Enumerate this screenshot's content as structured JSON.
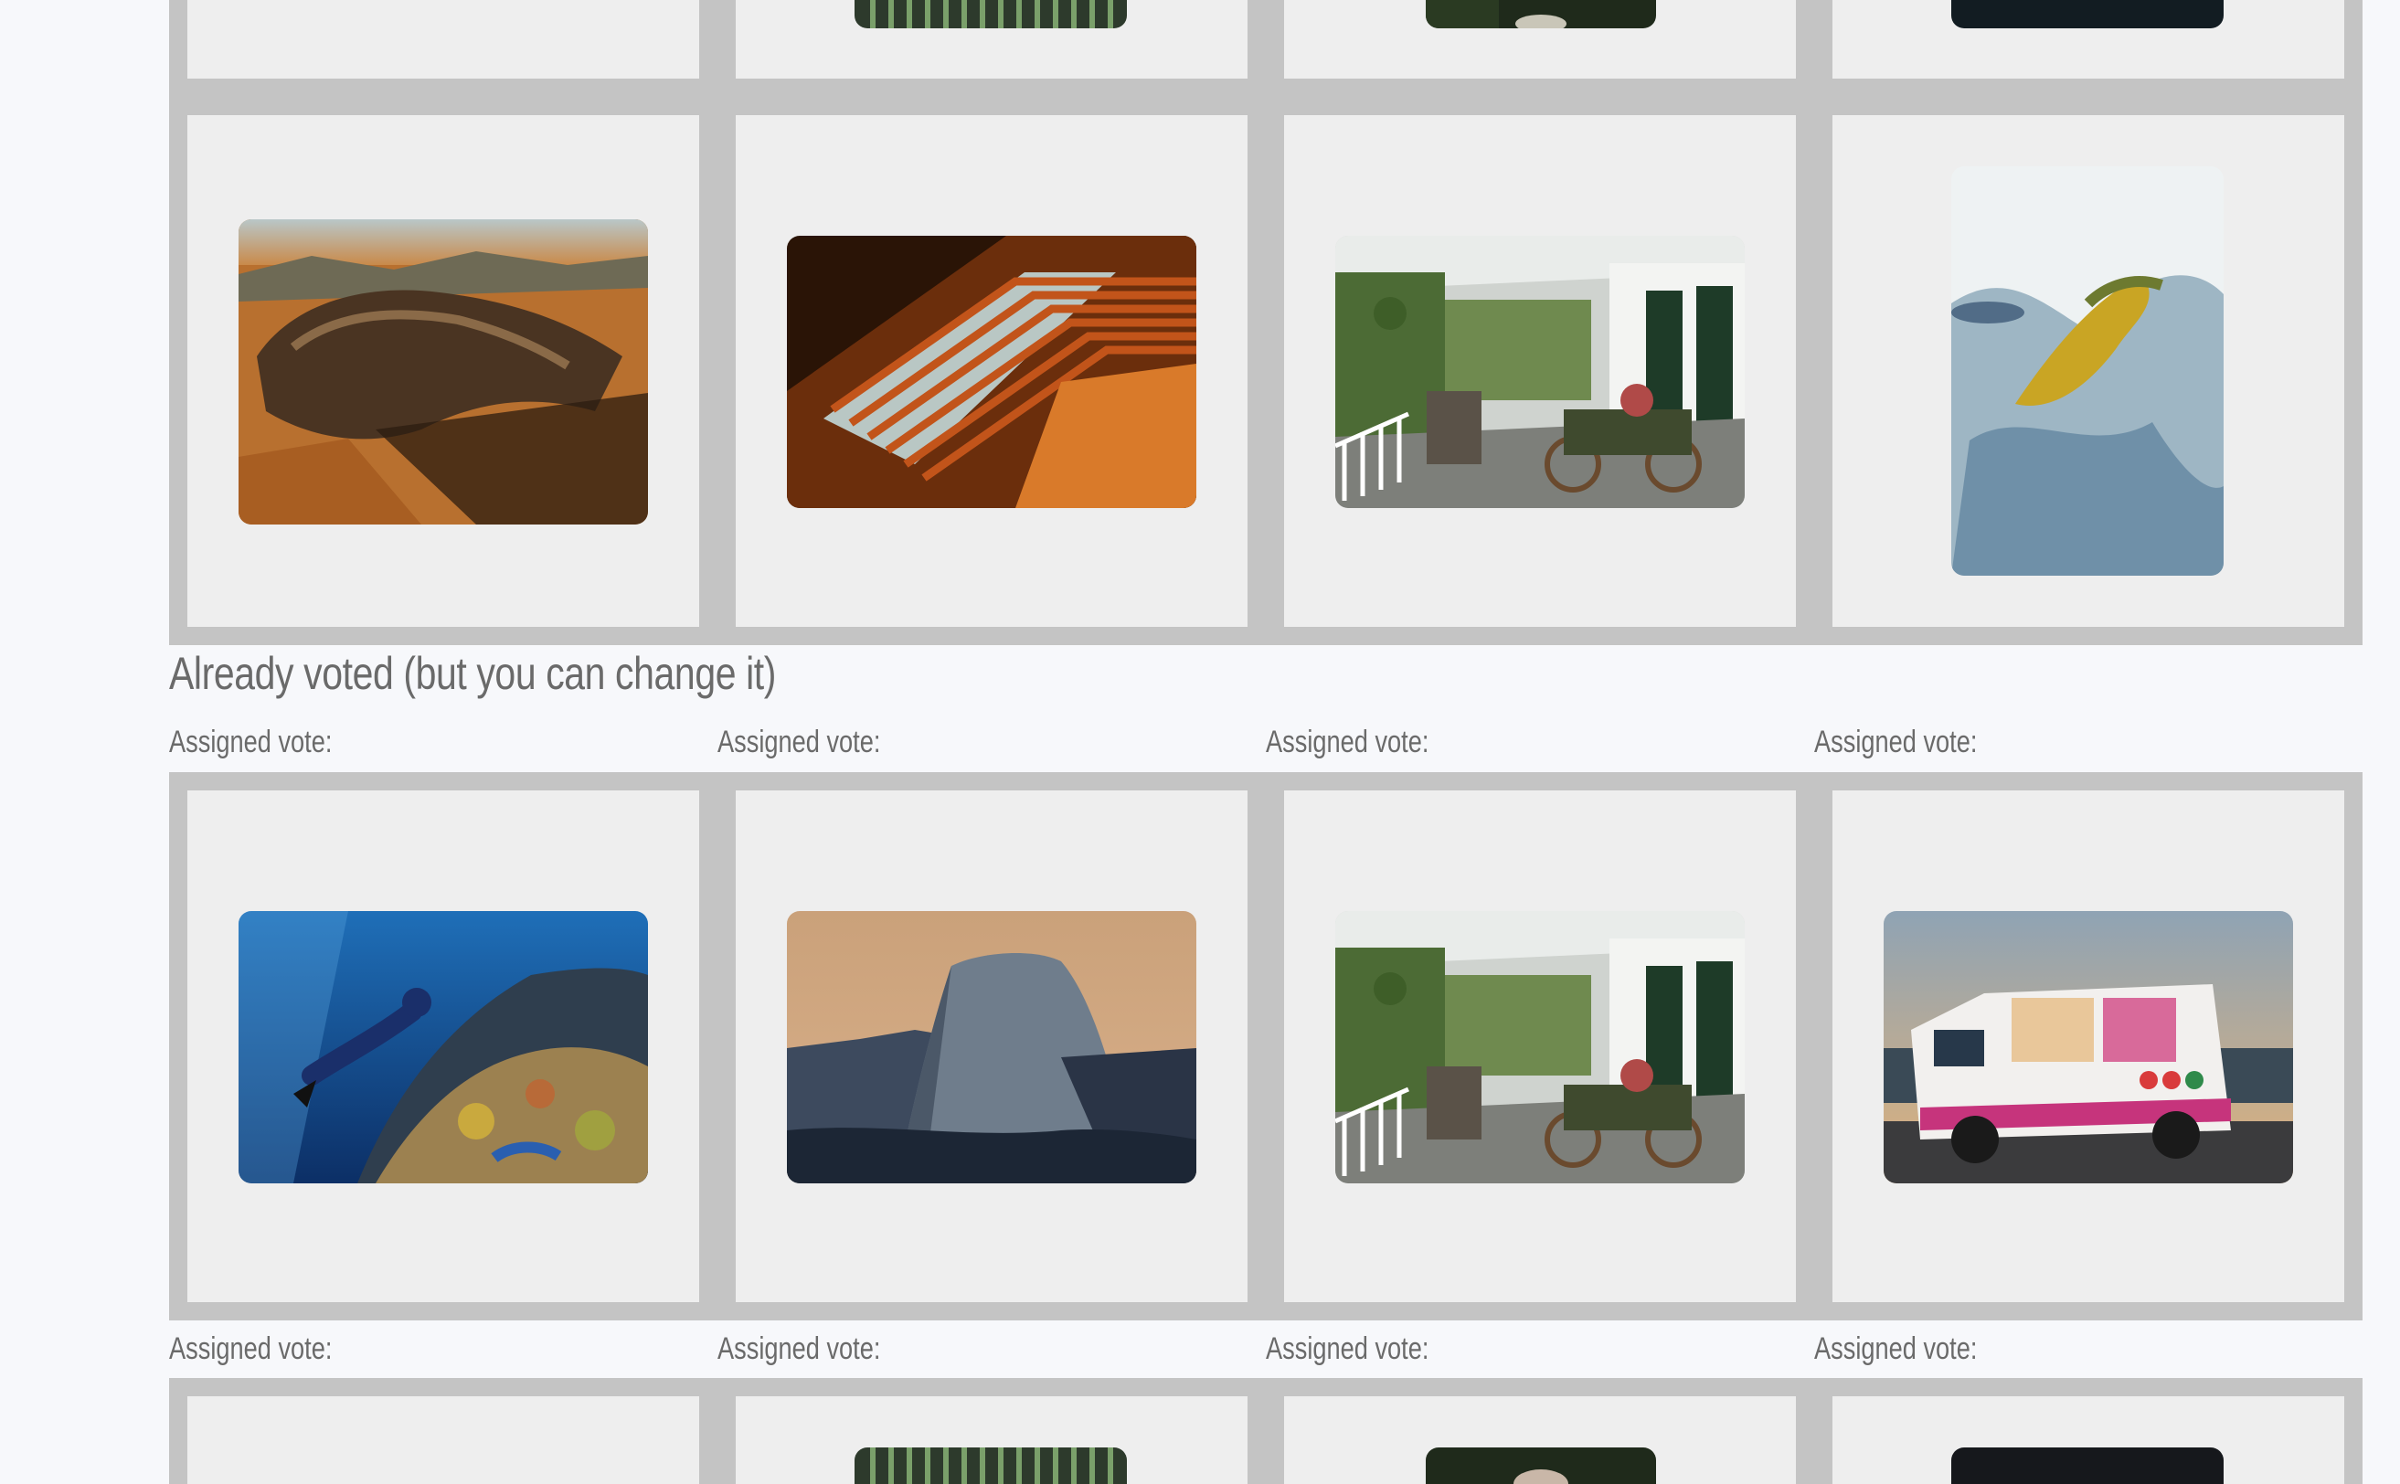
{
  "sections": {
    "voted_heading": "Already voted (but you can change it)"
  },
  "vote_labels": {
    "row1": [
      "Assigned vote:",
      "Assigned vote:",
      "Assigned vote:",
      "Assigned vote:"
    ],
    "row2": [
      "Assigned vote:",
      "Assigned vote:",
      "Assigned vote:",
      "Assigned vote:"
    ]
  },
  "images": {
    "top_row": [
      "desert-rock-formations",
      "orange-staircase",
      "covered-porch",
      "abstract-blue-yellow-art"
    ],
    "voted_row": [
      "underwater-diver-coral-reef",
      "half-dome-mountain",
      "covered-porch",
      "ice-cream-van"
    ],
    "partial_top": [
      "green-hedge-image",
      "forest-image",
      "dark-image"
    ],
    "partial_bottom": [
      "green-hedge-image",
      "forest-portrait-image",
      "dark-image"
    ]
  },
  "colors": {
    "page_background": "#f7f8fb",
    "grid_frame": "#c4c4c4",
    "cell_background": "#eeeeee",
    "text": "#6a6a6a"
  }
}
